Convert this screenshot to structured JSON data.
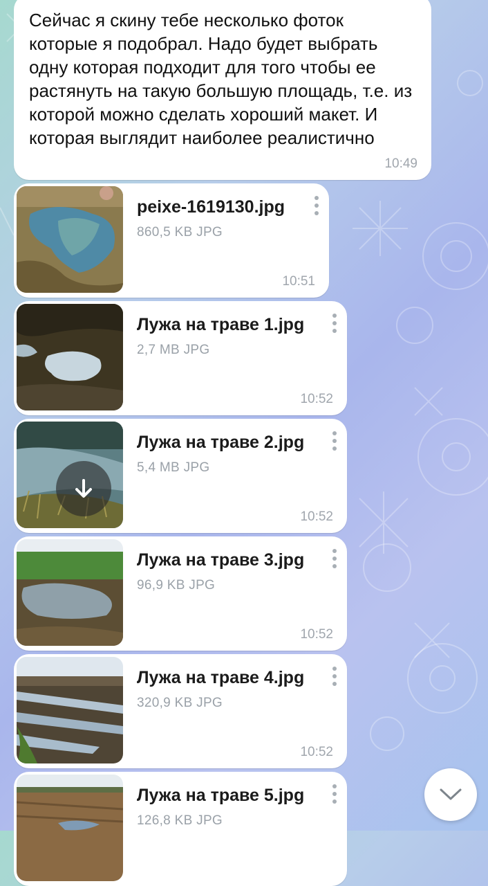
{
  "chat": {
    "text_message": {
      "text": "Сейчас я скину тебе несколько фоток которые я подобрал. Надо будет выбрать одну которая подходит для того чтобы ее растянуть на такую большую площадь, т.е. из которой можно сделать хороший макет. И которая выглядит наиболее реалистично",
      "time": "10:49"
    },
    "files": [
      {
        "name": "peixe-1619130.jpg",
        "meta": "860,5 KB JPG",
        "time": "10:51"
      },
      {
        "name": "Лужа на траве 1.jpg",
        "meta": "2,7 MB JPG",
        "time": "10:52"
      },
      {
        "name": "Лужа на траве 2.jpg",
        "meta": "5,4 MB JPG",
        "time": "10:52"
      },
      {
        "name": "Лужа на траве 3.jpg",
        "meta": "96,9 KB JPG",
        "time": "10:52"
      },
      {
        "name": "Лужа на траве 4.jpg",
        "meta": "320,9 KB JPG",
        "time": "10:52"
      },
      {
        "name": "Лужа на траве 5.jpg",
        "meta": "126,8 KB JPG",
        "time": ""
      }
    ]
  },
  "icons": {
    "download": "download-arrow-icon",
    "scroll_down": "chevron-down-icon",
    "more": "more-vertical-icon"
  },
  "colors": {
    "bubble": "#ffffff",
    "filename": "#1b1b1b",
    "meta": "#9aa1a8"
  }
}
